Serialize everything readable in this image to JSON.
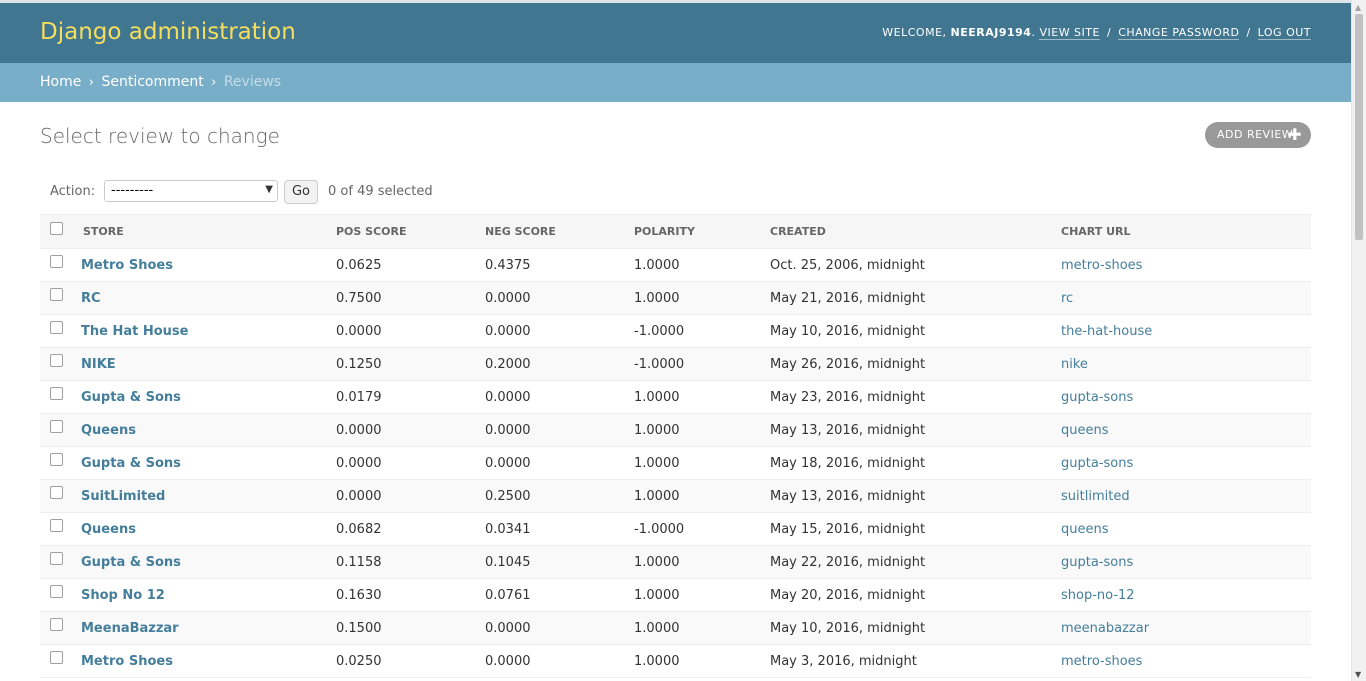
{
  "header": {
    "site_name": "Django administration",
    "welcome_prefix": "Welcome,",
    "username": "NEERAJ9194",
    "username_suffix": ".",
    "view_site": "View site",
    "change_password": "Change password",
    "log_out": "Log out",
    "separator": "/"
  },
  "breadcrumbs": {
    "home": "Home",
    "app": "Senticomment",
    "current": "Reviews",
    "arrow": "›"
  },
  "page": {
    "title": "Select review to change",
    "add_button": "Add review",
    "add_icon": "plus-icon"
  },
  "actions": {
    "label": "Action:",
    "selected_option": "---------",
    "go_button": "Go",
    "selection_count": "0 of 49 selected"
  },
  "table": {
    "columns": [
      "Store",
      "Pos score",
      "Neg score",
      "Polarity",
      "Created",
      "Chart URL"
    ],
    "rows": [
      {
        "store": "Metro Shoes",
        "pos": "0.0625",
        "neg": "0.4375",
        "polarity": "1.0000",
        "created": "Oct. 25, 2006, midnight",
        "url": "metro-shoes"
      },
      {
        "store": "RC",
        "pos": "0.7500",
        "neg": "0.0000",
        "polarity": "1.0000",
        "created": "May 21, 2016, midnight",
        "url": "rc"
      },
      {
        "store": "The Hat House",
        "pos": "0.0000",
        "neg": "0.0000",
        "polarity": "-1.0000",
        "created": "May 10, 2016, midnight",
        "url": "the-hat-house"
      },
      {
        "store": "NIKE",
        "pos": "0.1250",
        "neg": "0.2000",
        "polarity": "-1.0000",
        "created": "May 26, 2016, midnight",
        "url": "nike"
      },
      {
        "store": "Gupta & Sons",
        "pos": "0.0179",
        "neg": "0.0000",
        "polarity": "1.0000",
        "created": "May 23, 2016, midnight",
        "url": "gupta-sons"
      },
      {
        "store": "Queens",
        "pos": "0.0000",
        "neg": "0.0000",
        "polarity": "1.0000",
        "created": "May 13, 2016, midnight",
        "url": "queens"
      },
      {
        "store": "Gupta & Sons",
        "pos": "0.0000",
        "neg": "0.0000",
        "polarity": "1.0000",
        "created": "May 18, 2016, midnight",
        "url": "gupta-sons"
      },
      {
        "store": "SuitLimited",
        "pos": "0.0000",
        "neg": "0.2500",
        "polarity": "1.0000",
        "created": "May 13, 2016, midnight",
        "url": "suitlimited"
      },
      {
        "store": "Queens",
        "pos": "0.0682",
        "neg": "0.0341",
        "polarity": "-1.0000",
        "created": "May 15, 2016, midnight",
        "url": "queens"
      },
      {
        "store": "Gupta & Sons",
        "pos": "0.1158",
        "neg": "0.1045",
        "polarity": "1.0000",
        "created": "May 22, 2016, midnight",
        "url": "gupta-sons"
      },
      {
        "store": "Shop No 12",
        "pos": "0.1630",
        "neg": "0.0761",
        "polarity": "1.0000",
        "created": "May 20, 2016, midnight",
        "url": "shop-no-12"
      },
      {
        "store": "MeenaBazzar",
        "pos": "0.1500",
        "neg": "0.0000",
        "polarity": "1.0000",
        "created": "May 10, 2016, midnight",
        "url": "meenabazzar"
      },
      {
        "store": "Metro Shoes",
        "pos": "0.0250",
        "neg": "0.0000",
        "polarity": "1.0000",
        "created": "May 3, 2016, midnight",
        "url": "metro-shoes"
      }
    ]
  },
  "colors": {
    "header_bg": "#417690",
    "branding": "#f5dd5d",
    "breadcrumb_bg": "#79aec8",
    "link": "#447e9b"
  }
}
